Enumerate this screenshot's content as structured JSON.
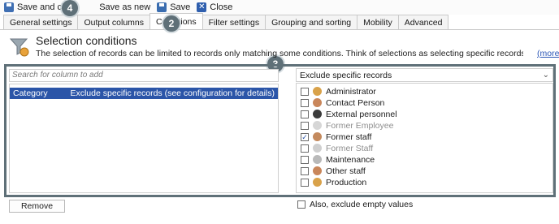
{
  "toolbar": {
    "save_close": "Save and close",
    "save_new": "Save as new",
    "save": "Save",
    "close": "Close"
  },
  "tabs": [
    {
      "label": "General settings"
    },
    {
      "label": "Output columns"
    },
    {
      "label": "Conditions"
    },
    {
      "label": "Filter settings"
    },
    {
      "label": "Grouping and sorting"
    },
    {
      "label": "Mobility"
    },
    {
      "label": "Advanced"
    }
  ],
  "active_tab": "Conditions",
  "badges": [
    "4",
    "2",
    "3"
  ],
  "heading": {
    "title": "Selection conditions",
    "description": "The selection of records can be limited to records only matching some conditions. Think of selections as selecting specific records from the database that meets certain...",
    "more_link": "(more)"
  },
  "left": {
    "search_placeholder": "Search for column to add",
    "row": {
      "col1": "Category",
      "col2": "Exclude specific records (see configuration for details)"
    },
    "remove_button": "Remove"
  },
  "right": {
    "dropdown_value": "Exclude specific records",
    "items": [
      {
        "label": "Administrator",
        "checked": false,
        "dim": false,
        "icon": "admin-user-icon"
      },
      {
        "label": "Contact Person",
        "checked": false,
        "dim": false,
        "icon": "contact-user-icon"
      },
      {
        "label": "External personnel",
        "checked": false,
        "dim": false,
        "icon": "external-user-icon"
      },
      {
        "label": "Former Employee",
        "checked": false,
        "dim": true,
        "icon": "former-employee-icon"
      },
      {
        "label": "Former staff",
        "checked": true,
        "dim": false,
        "icon": "former-staff-icon"
      },
      {
        "label": "Former Staff",
        "checked": false,
        "dim": true,
        "icon": "former-staff-alt-icon"
      },
      {
        "label": "Maintenance",
        "checked": false,
        "dim": false,
        "icon": "maintenance-user-icon"
      },
      {
        "label": "Other staff",
        "checked": false,
        "dim": false,
        "icon": "other-staff-icon"
      },
      {
        "label": "Production",
        "checked": false,
        "dim": false,
        "icon": "production-user-icon"
      }
    ],
    "also_exclude_label": "Also, exclude empty values"
  },
  "colors": {
    "badge": "#5f7078",
    "selection": "#2b55a8",
    "link": "#2a55b5"
  }
}
